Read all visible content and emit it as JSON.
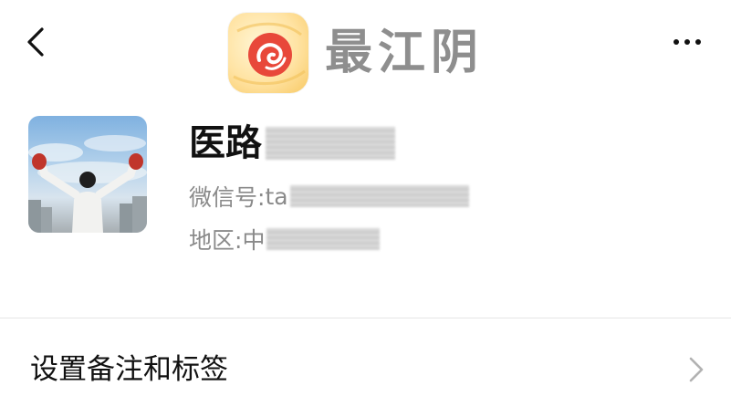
{
  "header": {
    "back_icon": "chevron-left-icon",
    "more_icon": "more-horizontal-icon"
  },
  "brand": {
    "text": "最江阴",
    "colors": {
      "logo_background": "#ffe3a3",
      "logo_mark": "#e8483a",
      "text": "#8e8e8e"
    }
  },
  "profile": {
    "avatar_icon": "avatar-image",
    "name_visible": "医路",
    "wechat_label": "微信号:",
    "wechat_value_visible": "ta",
    "region_label": "地区:",
    "region_value_visible": "中"
  },
  "menu": {
    "items": [
      {
        "label": "设置备注和标签",
        "icon": "chevron-right-icon"
      }
    ]
  },
  "colors": {
    "primary_text": "#111111",
    "secondary_text": "#8a8a8a",
    "divider": "#e6e6e6",
    "background": "#ffffff"
  }
}
